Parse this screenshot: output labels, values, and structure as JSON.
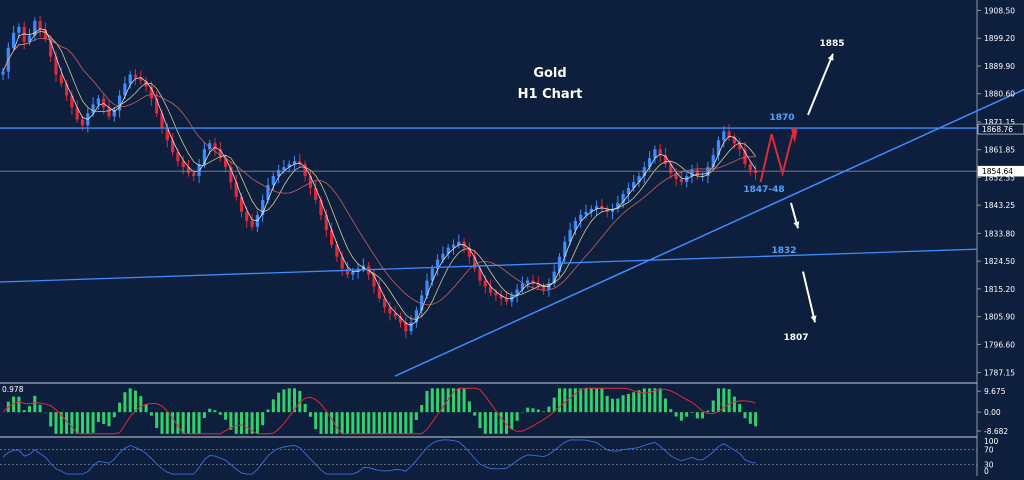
{
  "chart_data": [
    {
      "type": "candlestick",
      "title": "Gold",
      "subtitle": "H1 Chart",
      "ylim": [
        1784,
        1912
      ],
      "ticks": [
        "1908.50",
        "1899.20",
        "1889.90",
        "1880.60",
        "1871.15",
        "1861.85",
        "1852.55",
        "1843.25",
        "1833.80",
        "1824.50",
        "1815.20",
        "1805.90",
        "1796.60",
        "1787.15"
      ],
      "tick_values": [
        1908.5,
        1899.2,
        1889.9,
        1880.6,
        1871.15,
        1861.85,
        1852.55,
        1843.25,
        1833.8,
        1824.5,
        1815.2,
        1805.9,
        1796.6,
        1787.15
      ],
      "price_tags": [
        {
          "label": "1868.76",
          "value": 1868.76,
          "color": "#ffffff",
          "bg": "#0d1f3c"
        },
        {
          "label": "1854.64",
          "value": 1854.64,
          "color": "#000000",
          "bg": "#ffffff"
        }
      ],
      "closes": [
        1888,
        1896,
        1901,
        1903,
        1898,
        1900,
        1905,
        1902,
        1899,
        1893,
        1887,
        1884,
        1880,
        1876,
        1872,
        1870,
        1874,
        1877,
        1879,
        1876,
        1873,
        1875,
        1880,
        1884,
        1887,
        1886,
        1885,
        1883,
        1879,
        1874,
        1869,
        1865,
        1861,
        1858,
        1856,
        1854,
        1853,
        1857,
        1862,
        1864,
        1862,
        1859,
        1856,
        1851,
        1846,
        1841,
        1838,
        1836,
        1840,
        1845,
        1850,
        1853,
        1855,
        1856,
        1857,
        1858,
        1857,
        1853,
        1849,
        1845,
        1840,
        1835,
        1830,
        1826,
        1822,
        1820,
        1821,
        1822,
        1823,
        1820,
        1816,
        1812,
        1809,
        1807,
        1806,
        1804,
        1801,
        1804,
        1808,
        1813,
        1818,
        1822,
        1825,
        1827,
        1829,
        1830,
        1831,
        1829,
        1826,
        1822,
        1818,
        1816,
        1814,
        1813,
        1812,
        1811,
        1813,
        1815,
        1817,
        1818,
        1817,
        1816,
        1815,
        1817,
        1821,
        1826,
        1831,
        1835,
        1838,
        1840,
        1841,
        1842,
        1843,
        1842,
        1841,
        1842,
        1844,
        1847,
        1849,
        1851,
        1853,
        1856,
        1859,
        1862,
        1860,
        1857,
        1854,
        1852,
        1851,
        1853,
        1855,
        1853,
        1853,
        1856,
        1860,
        1865,
        1868,
        1866,
        1864,
        1862,
        1857,
        1855,
        1854
      ],
      "osc": {
        "ticks": [
          "0.978",
          "9.675",
          "0.00",
          "-8.682"
        ],
        "tick_values": [
          11.5,
          9.675,
          0,
          -8.682
        ],
        "ylim": [
          -11,
          13
        ]
      },
      "rsi": {
        "ticks": [
          "100",
          "70",
          "30",
          "0"
        ],
        "tick_values": [
          100,
          70,
          30,
          0
        ],
        "ylim": [
          0,
          100
        ]
      },
      "annotations": [
        {
          "label": "1885",
          "color": "white",
          "price": 1897,
          "bar": 119
        },
        {
          "label": "1870",
          "color": "blue",
          "price": 1873,
          "bar": 111
        },
        {
          "label": "1847-48",
          "color": "blue",
          "price": 1849,
          "bar": 110
        },
        {
          "label": "1832",
          "color": "blue",
          "price": 1826,
          "bar": 113
        },
        {
          "label": "1807",
          "color": "white",
          "price": 1798,
          "bar": 113
        }
      ]
    }
  ]
}
